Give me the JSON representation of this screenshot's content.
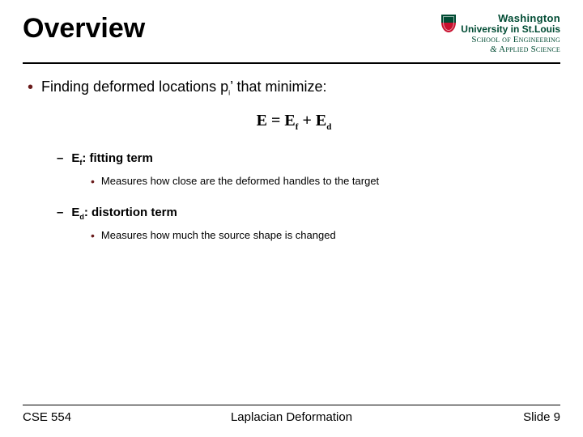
{
  "title": "Overview",
  "logo": {
    "name_top": "Washington",
    "name_bottom": "University in St.Louis",
    "school_line1": "School of Engineering",
    "school_line2_prefix": "&",
    "school_line2": " Applied Science"
  },
  "bullet1": {
    "prefix": "Finding deformed locations p",
    "sub": "i",
    "suffix": "’ that minimize:"
  },
  "equation": {
    "E": "E",
    "eq": " = ",
    "Ef": "E",
    "f": "f",
    "plus": " + ",
    "Ed": "E",
    "d": "d"
  },
  "term1": {
    "sym": "E",
    "sub": "f",
    "label": ": fitting term",
    "desc": "Measures how close are the deformed handles to the target"
  },
  "term2": {
    "sym": "E",
    "sub": "d",
    "label": ": distortion term",
    "desc": "Measures how much the source shape is changed"
  },
  "footer": {
    "left": "CSE 554",
    "center": "Laplacian Deformation",
    "right": "Slide 9"
  }
}
